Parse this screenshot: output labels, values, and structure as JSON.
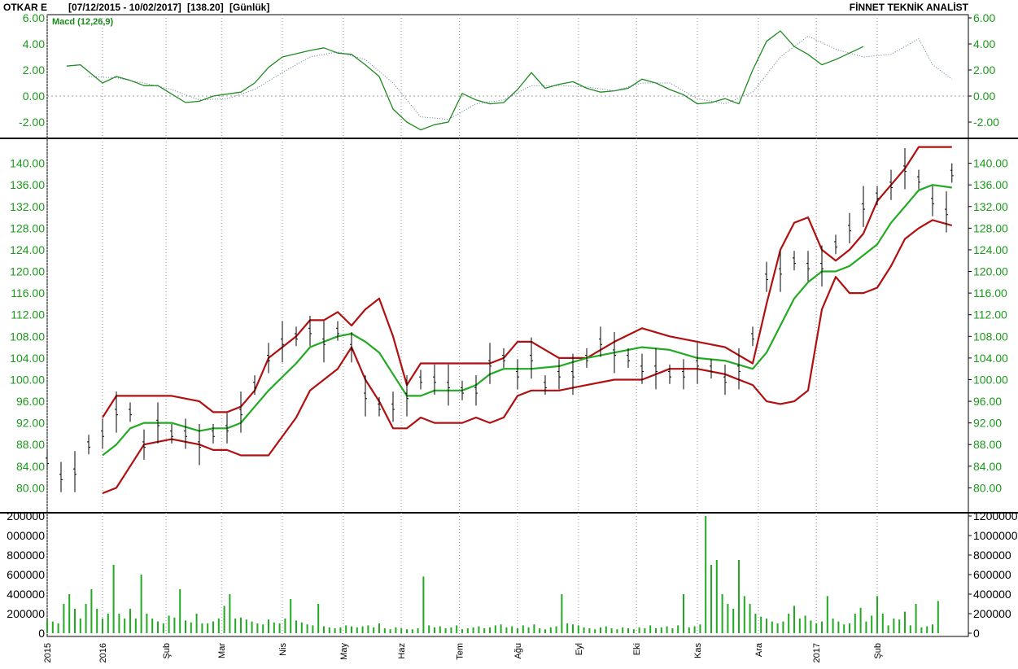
{
  "header": {
    "symbol": "OTKAR E",
    "range": "[07/12/2015 - 10/02/2017]",
    "last": "[138.20]",
    "period": "[Günlük]",
    "brand": "FİNNET TEKNİK ANALİST"
  },
  "colors": {
    "macd": "#1f8a1f",
    "signal": "#5a7a9a",
    "band": "#b01010",
    "mid": "#22aa22",
    "volume": "#22aa22",
    "price": "#000000",
    "grid": "#9a9a9a",
    "tick_green": "#1a9a1a"
  },
  "chart_data": [
    {
      "type": "line",
      "panel": "macd",
      "title": "Macd (12,26,9)",
      "ylim": [
        -3,
        6
      ],
      "yticks_left": [
        "6.00",
        "4.00",
        "2.00",
        "0.00",
        "-2.00"
      ],
      "yticks_right": [
        "6.00",
        "4.00",
        "2.00",
        "0.00",
        "-2.00"
      ],
      "yticks_values": [
        6,
        4,
        2,
        0,
        -2
      ],
      "reference_line": 0,
      "series": [
        {
          "name": "Macd",
          "style": "solid",
          "x": [
            7,
            12,
            20,
            25,
            30,
            35,
            40,
            50,
            55,
            60,
            70,
            75,
            80,
            85,
            95,
            100,
            105,
            110,
            115,
            120,
            125,
            130,
            135,
            140,
            145,
            150,
            155,
            160,
            165,
            170,
            175,
            180,
            185,
            190,
            195,
            200,
            205,
            210,
            215,
            220,
            225,
            230,
            235,
            240,
            245,
            250,
            255,
            260,
            265,
            270,
            275,
            280,
            285,
            290,
            295
          ],
          "values": [
            2.3,
            2.4,
            1.0,
            1.5,
            1.2,
            0.8,
            0.8,
            -0.5,
            -0.4,
            0,
            0.3,
            1.0,
            2.2,
            3.0,
            3.5,
            3.7,
            3.3,
            3.2,
            2.4,
            1.5,
            -1.0,
            -2.0,
            -2.6,
            -2.2,
            -2.0,
            0.2,
            -0.3,
            -0.6,
            -0.5,
            0.5,
            1.8,
            0.6,
            0.9,
            1.1,
            0.6,
            0.3,
            0.4,
            0.6,
            1.3,
            1.0,
            0.5,
            0.1,
            -0.6,
            -0.5,
            -0.2,
            -0.6,
            2.0,
            4.2,
            5.0,
            3.8,
            3.2,
            2.4,
            2.8,
            3.3,
            3.8
          ]
        },
        {
          "name": "Signal",
          "style": "dotted",
          "x": [
            15,
            25,
            35,
            45,
            55,
            65,
            75,
            85,
            95,
            105,
            115,
            125,
            135,
            145,
            155,
            165,
            175,
            185,
            195,
            205,
            215,
            225,
            235,
            245,
            255,
            265,
            275,
            285,
            295,
            305,
            315,
            320,
            327
          ],
          "values": [
            1.5,
            1.4,
            1.0,
            0.5,
            -0.3,
            -0.2,
            0.5,
            1.8,
            3.0,
            3.4,
            2.8,
            1.0,
            -1.6,
            -1.8,
            -0.6,
            -0.3,
            0.8,
            0.8,
            0.7,
            0.4,
            1.0,
            1.0,
            -0.2,
            -0.6,
            0.3,
            3.0,
            4.6,
            3.6,
            3.0,
            3.2,
            4.4,
            2.4,
            1.3
          ]
        }
      ]
    },
    {
      "type": "line",
      "panel": "price",
      "title": "",
      "ylim": [
        76,
        144
      ],
      "yticks_left": [
        "140.00",
        "136.00",
        "132.00",
        "128.00",
        "124.00",
        "120.00",
        "116.00",
        "112.00",
        "108.00",
        "104.00",
        "100.00",
        "96.00",
        "92.00",
        "88.00",
        "84.00",
        "80.00"
      ],
      "yticks_right": [
        "140.00",
        "136.00",
        "132.00",
        "128.00",
        "124.00",
        "120.00",
        "116.00",
        "112.00",
        "108.00",
        "104.00",
        "100.00",
        "96.00",
        "92.00",
        "88.00",
        "84.00",
        "80.00"
      ],
      "yticks_values": [
        140,
        136,
        132,
        128,
        124,
        120,
        116,
        112,
        108,
        104,
        100,
        96,
        92,
        88,
        84,
        80
      ],
      "series": [
        {
          "name": "Upper Band",
          "x": [
            20,
            25,
            30,
            35,
            45,
            55,
            60,
            65,
            70,
            75,
            80,
            90,
            95,
            100,
            105,
            110,
            115,
            120,
            125,
            130,
            135,
            140,
            145,
            150,
            155,
            160,
            165,
            170,
            175,
            185,
            195,
            205,
            215,
            225,
            235,
            245,
            255,
            260,
            265,
            270,
            275,
            280,
            285,
            290,
            295,
            300,
            305,
            310,
            315,
            320,
            327
          ],
          "values": [
            93,
            97,
            97,
            97,
            97,
            96,
            94,
            94,
            95,
            98,
            104,
            108,
            111,
            111,
            112.5,
            110,
            113,
            115,
            108,
            99,
            103,
            103,
            103,
            103,
            103,
            103,
            104,
            107,
            107,
            104,
            104,
            107,
            109.5,
            108,
            107,
            106,
            103,
            114,
            124,
            129,
            130,
            124,
            122,
            124,
            127,
            133,
            136,
            139,
            143,
            143,
            143
          ]
        },
        {
          "name": "Middle Band",
          "x": [
            20,
            25,
            30,
            35,
            45,
            55,
            60,
            65,
            70,
            75,
            80,
            90,
            95,
            100,
            105,
            110,
            115,
            120,
            125,
            130,
            135,
            140,
            145,
            150,
            155,
            160,
            165,
            170,
            175,
            185,
            195,
            205,
            215,
            225,
            235,
            245,
            255,
            260,
            265,
            270,
            275,
            280,
            285,
            290,
            295,
            300,
            305,
            310,
            315,
            320,
            327
          ],
          "values": [
            86,
            88,
            91,
            92,
            92,
            90.5,
            91,
            91,
            92,
            95,
            98,
            103,
            106,
            107,
            108,
            108.5,
            107,
            105,
            101,
            97,
            97,
            98,
            98,
            98,
            99,
            101,
            102,
            102,
            102,
            102.5,
            104,
            105,
            106,
            105.5,
            104,
            103.5,
            102,
            105,
            110,
            115,
            118,
            120,
            120,
            121,
            123,
            125,
            129,
            132,
            135,
            136,
            135.5
          ]
        },
        {
          "name": "Lower Band",
          "x": [
            20,
            25,
            30,
            35,
            45,
            55,
            60,
            65,
            70,
            75,
            80,
            90,
            95,
            100,
            105,
            110,
            115,
            120,
            125,
            130,
            135,
            140,
            145,
            150,
            155,
            160,
            165,
            170,
            175,
            185,
            195,
            205,
            215,
            225,
            235,
            245,
            255,
            260,
            265,
            270,
            275,
            280,
            285,
            290,
            295,
            300,
            305,
            310,
            315,
            320,
            327
          ],
          "values": [
            79,
            80,
            84,
            88,
            89,
            88,
            87,
            87,
            86,
            86,
            86,
            93,
            98,
            100,
            102,
            106,
            100,
            96,
            91,
            91,
            93,
            92,
            92,
            92,
            93,
            92,
            93,
            97,
            98,
            98,
            99,
            100,
            100,
            102,
            102,
            101,
            99,
            96,
            95.5,
            96,
            98,
            113,
            119,
            116,
            116,
            117,
            121,
            126,
            128,
            129.5,
            128.5
          ]
        },
        {
          "name": "Price",
          "style": "ohlc",
          "x": [
            0,
            5,
            10,
            15,
            20,
            25,
            30,
            35,
            40,
            45,
            50,
            55,
            60,
            65,
            70,
            75,
            80,
            85,
            90,
            95,
            100,
            105,
            110,
            115,
            120,
            125,
            130,
            135,
            140,
            145,
            150,
            155,
            160,
            165,
            170,
            175,
            180,
            185,
            190,
            195,
            200,
            205,
            210,
            215,
            220,
            225,
            230,
            235,
            240,
            245,
            250,
            255,
            260,
            265,
            270,
            275,
            280,
            285,
            290,
            295,
            300,
            305,
            310,
            315,
            320,
            325,
            327
          ],
          "values": [
            85,
            82,
            83,
            88,
            90,
            94,
            94,
            88,
            92,
            90,
            90,
            88,
            90,
            91,
            94,
            99,
            104,
            107,
            108,
            109,
            107,
            109,
            106,
            97,
            95,
            95,
            97,
            100,
            100,
            99,
            98,
            98,
            103,
            104,
            101,
            104,
            99,
            101,
            101,
            104,
            107,
            105,
            104,
            102,
            102,
            101,
            101,
            103,
            102,
            100,
            102,
            108,
            119,
            120,
            122,
            121,
            121,
            125,
            128,
            132,
            134,
            136,
            139,
            137,
            133,
            131,
            138.2
          ]
        }
      ]
    },
    {
      "type": "bar",
      "panel": "volume",
      "title": "",
      "ylim": [
        0,
        1200000
      ],
      "yticks_left": [
        "200000",
        "000000",
        "800000",
        "600000",
        "400000",
        "200000",
        "0"
      ],
      "yticks_right": [
        "1200000",
        "1000000",
        "800000",
        "600000",
        "400000",
        "200000",
        "0"
      ],
      "yticks_values": [
        1200000,
        1000000,
        800000,
        600000,
        400000,
        200000,
        0
      ],
      "x": [
        0,
        2,
        4,
        6,
        8,
        10,
        12,
        14,
        16,
        18,
        20,
        22,
        24,
        26,
        28,
        30,
        32,
        34,
        36,
        38,
        40,
        42,
        44,
        46,
        48,
        50,
        52,
        54,
        56,
        58,
        60,
        62,
        64,
        66,
        68,
        70,
        72,
        74,
        76,
        78,
        80,
        82,
        84,
        86,
        88,
        90,
        92,
        94,
        96,
        98,
        100,
        102,
        104,
        106,
        108,
        110,
        112,
        114,
        116,
        118,
        120,
        122,
        124,
        126,
        128,
        130,
        132,
        134,
        136,
        138,
        140,
        142,
        144,
        146,
        148,
        150,
        152,
        154,
        156,
        158,
        160,
        162,
        164,
        166,
        168,
        170,
        172,
        174,
        176,
        178,
        180,
        182,
        184,
        186,
        188,
        190,
        192,
        194,
        196,
        198,
        200,
        202,
        204,
        206,
        208,
        210,
        212,
        214,
        216,
        218,
        220,
        222,
        224,
        226,
        228,
        230,
        232,
        234,
        236,
        238,
        240,
        242,
        244,
        246,
        248,
        250,
        252,
        254,
        256,
        258,
        260,
        262,
        264,
        266,
        268,
        270,
        272,
        274,
        276,
        278,
        280,
        282,
        284,
        286,
        288,
        290,
        292,
        294,
        296,
        298,
        300,
        302,
        304,
        306,
        308,
        310,
        312,
        314,
        316,
        318,
        320,
        322,
        324,
        326
      ],
      "values": [
        140000,
        120000,
        100000,
        300000,
        400000,
        250000,
        150000,
        300000,
        450000,
        250000,
        150000,
        200000,
        700000,
        200000,
        150000,
        250000,
        150000,
        600000,
        200000,
        150000,
        120000,
        100000,
        180000,
        160000,
        450000,
        130000,
        110000,
        200000,
        100000,
        100000,
        120000,
        150000,
        280000,
        400000,
        150000,
        160000,
        140000,
        120000,
        100000,
        90000,
        140000,
        110000,
        100000,
        150000,
        350000,
        130000,
        110000,
        90000,
        80000,
        300000,
        70000,
        60000,
        50000,
        60000,
        80000,
        70000,
        60000,
        70000,
        80000,
        60000,
        100000,
        50000,
        40000,
        60000,
        50000,
        40000,
        40000,
        50000,
        580000,
        80000,
        60000,
        70000,
        50000,
        60000,
        80000,
        40000,
        50000,
        60000,
        70000,
        50000,
        60000,
        80000,
        90000,
        60000,
        70000,
        50000,
        80000,
        60000,
        90000,
        50000,
        40000,
        60000,
        70000,
        400000,
        100000,
        90000,
        80000,
        60000,
        50000,
        40000,
        60000,
        70000,
        50000,
        40000,
        60000,
        50000,
        40000,
        60000,
        50000,
        80000,
        50000,
        60000,
        70000,
        50000,
        80000,
        400000,
        60000,
        70000,
        90000,
        1200000,
        700000,
        750000,
        400000,
        300000,
        250000,
        750000,
        380000,
        300000,
        200000,
        170000,
        150000,
        120000,
        100000,
        120000,
        200000,
        280000,
        150000,
        180000,
        130000,
        100000,
        120000,
        380000,
        150000,
        120000,
        90000,
        100000,
        200000,
        260000,
        120000,
        180000,
        380000,
        200000,
        80000,
        150000,
        140000,
        220000,
        80000,
        300000,
        60000,
        70000,
        90000,
        330000
      ]
    }
  ],
  "x_axis": {
    "labels": [
      {
        "text": "2015",
        "x": 0
      },
      {
        "text": "2016",
        "x": 20
      },
      {
        "text": "Şub",
        "x": 43
      },
      {
        "text": "Mar",
        "x": 63
      },
      {
        "text": "Nis",
        "x": 85
      },
      {
        "text": "May",
        "x": 107
      },
      {
        "text": "Haz",
        "x": 128
      },
      {
        "text": "Tem",
        "x": 149
      },
      {
        "text": "Ağu",
        "x": 170
      },
      {
        "text": "Eyl",
        "x": 192
      },
      {
        "text": "Eki",
        "x": 213
      },
      {
        "text": "Kas",
        "x": 235
      },
      {
        "text": "Ara",
        "x": 257
      },
      {
        "text": "2017",
        "x": 278
      },
      {
        "text": "Şub",
        "x": 300
      }
    ],
    "xlim": [
      0,
      330
    ]
  }
}
